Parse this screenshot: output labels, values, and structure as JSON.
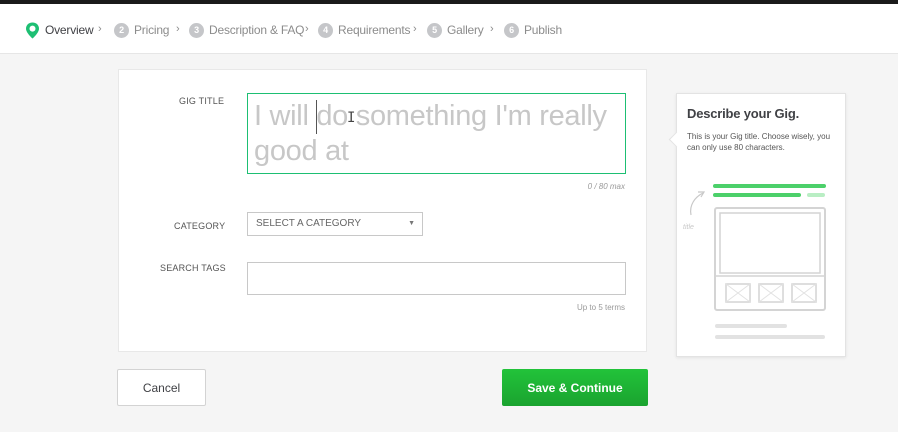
{
  "steps": [
    {
      "num": "1",
      "label": "Overview",
      "active": true
    },
    {
      "num": "2",
      "label": "Pricing"
    },
    {
      "num": "3",
      "label": "Description & FAQ"
    },
    {
      "num": "4",
      "label": "Requirements"
    },
    {
      "num": "5",
      "label": "Gallery"
    },
    {
      "num": "6",
      "label": "Publish"
    }
  ],
  "separator": "›",
  "form": {
    "gig_title_label": "GIG TITLE",
    "gig_title_placeholder": "I will do something I'm really good at",
    "gig_title_value": "",
    "char_counter": "0 / 80 max",
    "category_label": "CATEGORY",
    "category_selected": "SELECT A CATEGORY",
    "search_tags_label": "SEARCH TAGS",
    "search_tags_value": "",
    "search_tags_hint": "Up to 5 terms"
  },
  "buttons": {
    "cancel": "Cancel",
    "save_continue": "Save & Continue"
  },
  "tip": {
    "title": "Describe your Gig.",
    "text": "This is your Gig title. Choose wisely, you can only use 80 characters.",
    "illus_label": "title"
  },
  "colors": {
    "accent": "#1dbf73",
    "save_button": "#1ea02f",
    "step_inactive": "#c5c6c9"
  },
  "icons": {
    "overview": "map-pin-icon",
    "dropdown": "caret-down-icon",
    "text_cursor": "i-beam-cursor-icon"
  }
}
